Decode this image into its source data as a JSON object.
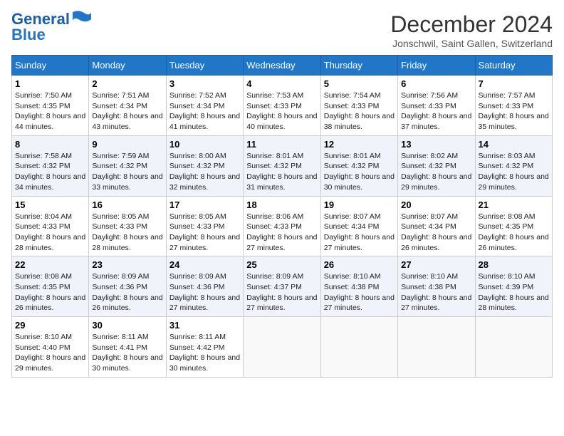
{
  "header": {
    "logo_line1": "General",
    "logo_line2": "Blue",
    "month": "December 2024",
    "location": "Jonschwil, Saint Gallen, Switzerland"
  },
  "weekdays": [
    "Sunday",
    "Monday",
    "Tuesday",
    "Wednesday",
    "Thursday",
    "Friday",
    "Saturday"
  ],
  "weeks": [
    [
      {
        "day": "1",
        "sunrise": "7:50 AM",
        "sunset": "4:35 PM",
        "daylight": "8 hours and 44 minutes."
      },
      {
        "day": "2",
        "sunrise": "7:51 AM",
        "sunset": "4:34 PM",
        "daylight": "8 hours and 43 minutes."
      },
      {
        "day": "3",
        "sunrise": "7:52 AM",
        "sunset": "4:34 PM",
        "daylight": "8 hours and 41 minutes."
      },
      {
        "day": "4",
        "sunrise": "7:53 AM",
        "sunset": "4:33 PM",
        "daylight": "8 hours and 40 minutes."
      },
      {
        "day": "5",
        "sunrise": "7:54 AM",
        "sunset": "4:33 PM",
        "daylight": "8 hours and 38 minutes."
      },
      {
        "day": "6",
        "sunrise": "7:56 AM",
        "sunset": "4:33 PM",
        "daylight": "8 hours and 37 minutes."
      },
      {
        "day": "7",
        "sunrise": "7:57 AM",
        "sunset": "4:33 PM",
        "daylight": "8 hours and 35 minutes."
      }
    ],
    [
      {
        "day": "8",
        "sunrise": "7:58 AM",
        "sunset": "4:32 PM",
        "daylight": "8 hours and 34 minutes."
      },
      {
        "day": "9",
        "sunrise": "7:59 AM",
        "sunset": "4:32 PM",
        "daylight": "8 hours and 33 minutes."
      },
      {
        "day": "10",
        "sunrise": "8:00 AM",
        "sunset": "4:32 PM",
        "daylight": "8 hours and 32 minutes."
      },
      {
        "day": "11",
        "sunrise": "8:01 AM",
        "sunset": "4:32 PM",
        "daylight": "8 hours and 31 minutes."
      },
      {
        "day": "12",
        "sunrise": "8:01 AM",
        "sunset": "4:32 PM",
        "daylight": "8 hours and 30 minutes."
      },
      {
        "day": "13",
        "sunrise": "8:02 AM",
        "sunset": "4:32 PM",
        "daylight": "8 hours and 29 minutes."
      },
      {
        "day": "14",
        "sunrise": "8:03 AM",
        "sunset": "4:32 PM",
        "daylight": "8 hours and 29 minutes."
      }
    ],
    [
      {
        "day": "15",
        "sunrise": "8:04 AM",
        "sunset": "4:33 PM",
        "daylight": "8 hours and 28 minutes."
      },
      {
        "day": "16",
        "sunrise": "8:05 AM",
        "sunset": "4:33 PM",
        "daylight": "8 hours and 28 minutes."
      },
      {
        "day": "17",
        "sunrise": "8:05 AM",
        "sunset": "4:33 PM",
        "daylight": "8 hours and 27 minutes."
      },
      {
        "day": "18",
        "sunrise": "8:06 AM",
        "sunset": "4:33 PM",
        "daylight": "8 hours and 27 minutes."
      },
      {
        "day": "19",
        "sunrise": "8:07 AM",
        "sunset": "4:34 PM",
        "daylight": "8 hours and 27 minutes."
      },
      {
        "day": "20",
        "sunrise": "8:07 AM",
        "sunset": "4:34 PM",
        "daylight": "8 hours and 26 minutes."
      },
      {
        "day": "21",
        "sunrise": "8:08 AM",
        "sunset": "4:35 PM",
        "daylight": "8 hours and 26 minutes."
      }
    ],
    [
      {
        "day": "22",
        "sunrise": "8:08 AM",
        "sunset": "4:35 PM",
        "daylight": "8 hours and 26 minutes."
      },
      {
        "day": "23",
        "sunrise": "8:09 AM",
        "sunset": "4:36 PM",
        "daylight": "8 hours and 26 minutes."
      },
      {
        "day": "24",
        "sunrise": "8:09 AM",
        "sunset": "4:36 PM",
        "daylight": "8 hours and 27 minutes."
      },
      {
        "day": "25",
        "sunrise": "8:09 AM",
        "sunset": "4:37 PM",
        "daylight": "8 hours and 27 minutes."
      },
      {
        "day": "26",
        "sunrise": "8:10 AM",
        "sunset": "4:38 PM",
        "daylight": "8 hours and 27 minutes."
      },
      {
        "day": "27",
        "sunrise": "8:10 AM",
        "sunset": "4:38 PM",
        "daylight": "8 hours and 27 minutes."
      },
      {
        "day": "28",
        "sunrise": "8:10 AM",
        "sunset": "4:39 PM",
        "daylight": "8 hours and 28 minutes."
      }
    ],
    [
      {
        "day": "29",
        "sunrise": "8:10 AM",
        "sunset": "4:40 PM",
        "daylight": "8 hours and 29 minutes."
      },
      {
        "day": "30",
        "sunrise": "8:11 AM",
        "sunset": "4:41 PM",
        "daylight": "8 hours and 30 minutes."
      },
      {
        "day": "31",
        "sunrise": "8:11 AM",
        "sunset": "4:42 PM",
        "daylight": "8 hours and 30 minutes."
      },
      null,
      null,
      null,
      null
    ]
  ]
}
